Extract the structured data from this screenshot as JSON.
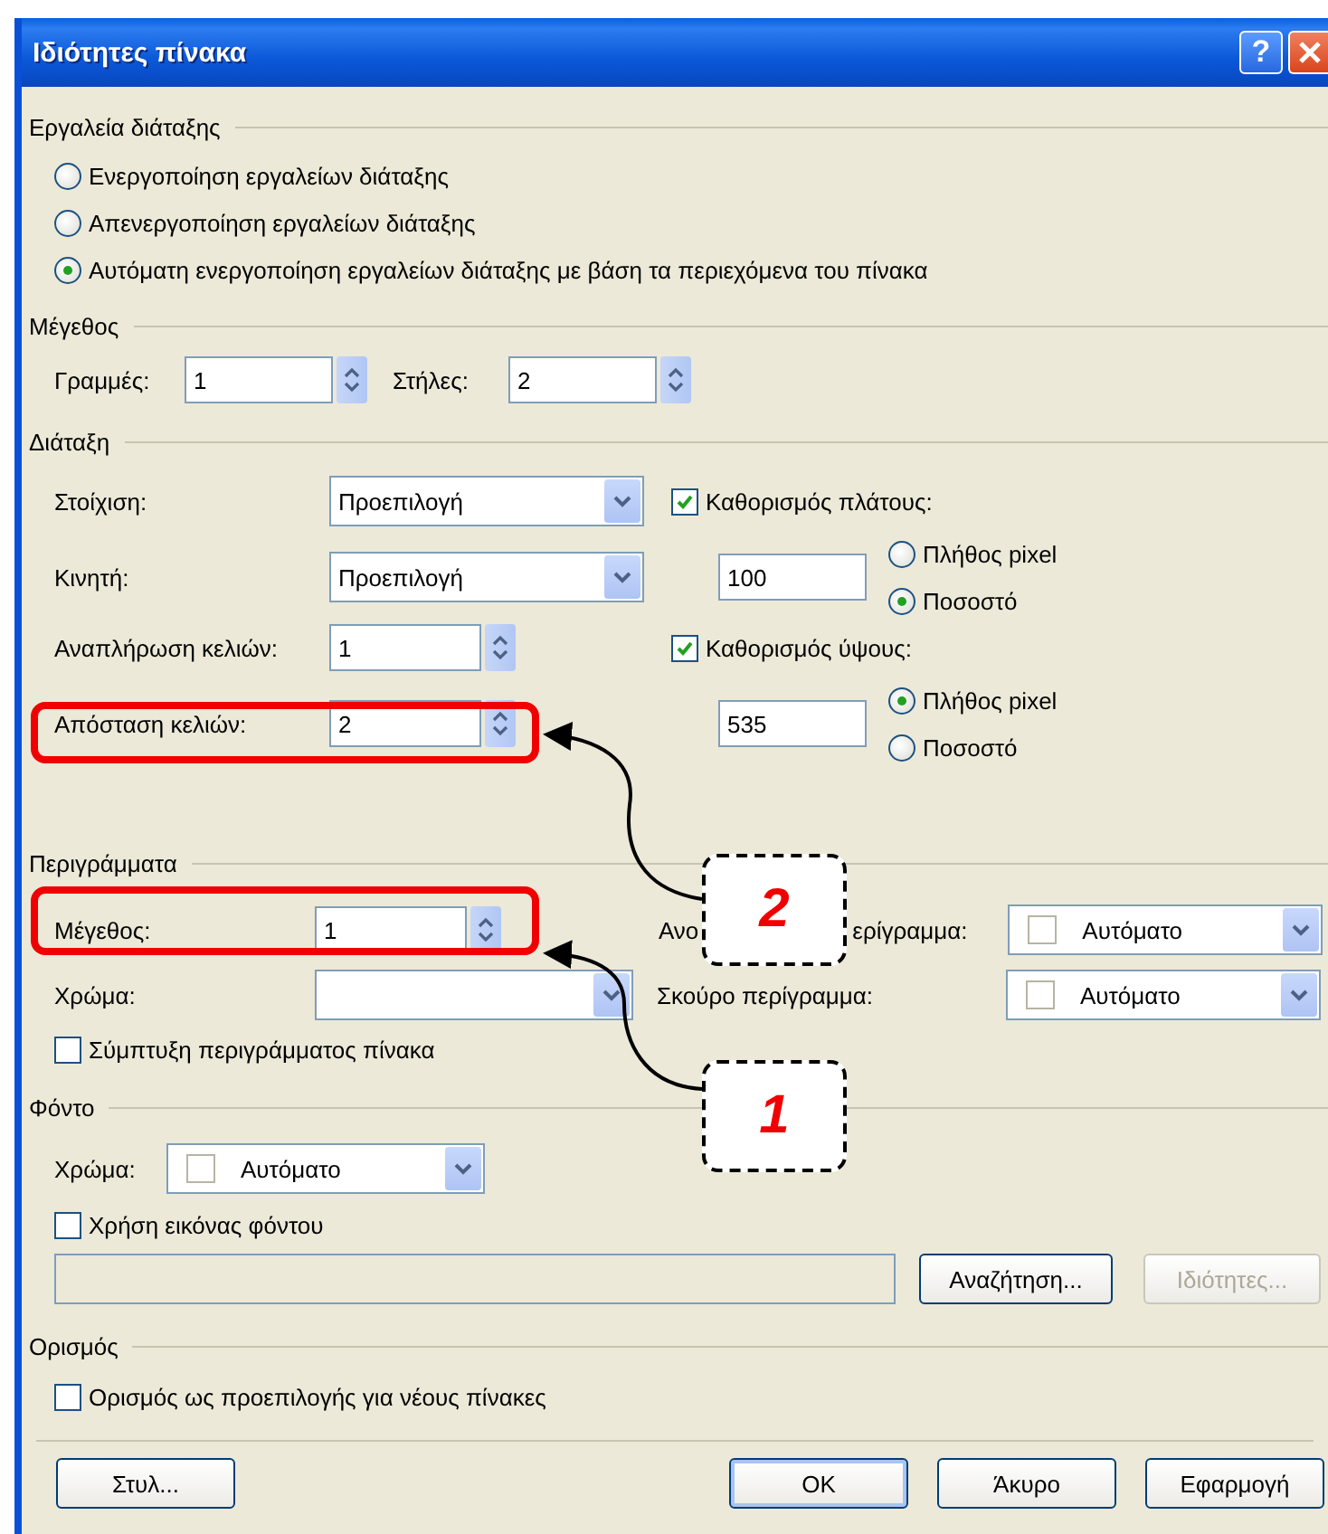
{
  "window": {
    "title": "Ιδιότητες πίνακα",
    "help_button": "?"
  },
  "layout_tools": {
    "title": "Εργαλεία διάταξης",
    "options": [
      {
        "label": "Ενεργοποίηση εργαλείων διάταξης",
        "selected": false
      },
      {
        "label": "Απενεργοποίηση εργαλείων διάταξης",
        "selected": false
      },
      {
        "label": "Αυτόματη ενεργοποίηση εργαλείων διάταξης με βάση τα περιεχόμενα του πίνακα",
        "selected": true
      }
    ]
  },
  "size": {
    "title": "Μέγεθος",
    "rows": {
      "label": "Γραμμές:",
      "value": "1"
    },
    "columns": {
      "label": "Στήλες:",
      "value": "2"
    }
  },
  "layout": {
    "title": "Διάταξη",
    "alignment": {
      "label": "Στοίχιση:",
      "value": "Προεπιλογή"
    },
    "float": {
      "label": "Κινητή:",
      "value": "Προεπιλογή"
    },
    "cell_padding": {
      "label": "Αναπλήρωση κελιών:",
      "value": "1"
    },
    "cell_spacing": {
      "label": "Απόσταση κελιών:",
      "value": "2"
    },
    "width": {
      "label": "Καθορισμός πλάτους:",
      "checked": true,
      "value": "100",
      "units": [
        {
          "label": "Πλήθος pixel",
          "selected": false
        },
        {
          "label": "Ποσοστό",
          "selected": true
        }
      ]
    },
    "height": {
      "label": "Καθορισμός ύψους:",
      "checked": true,
      "value": "535",
      "units": [
        {
          "label": "Πλήθος pixel",
          "selected": true
        },
        {
          "label": "Ποσοστό",
          "selected": false
        }
      ]
    }
  },
  "borders": {
    "title": "Περιγράμματα",
    "size": {
      "label": "Μέγεθος:",
      "value": "1"
    },
    "color": {
      "label": "Χρώμα:"
    },
    "light_border": {
      "label_start": "Ανο",
      "label_end": "ερίγραμμα:",
      "value": "Αυτόματο"
    },
    "dark_border": {
      "label": "Σκούρο περίγραμμα:",
      "value": "Αυτόματο"
    },
    "collapse": {
      "label": "Σύμπτυξη περιγράμματος πίνακα",
      "checked": false
    }
  },
  "background": {
    "title": "Φόντο",
    "color": {
      "label": "Χρώμα:",
      "value": "Αυτόματο"
    },
    "use_image": {
      "label": "Χρήση εικόνας φόντου",
      "checked": false
    },
    "buttons": [
      {
        "label": "Αναζήτηση...",
        "disabled": false
      },
      {
        "label": "Ιδιότητες...",
        "disabled": true
      }
    ]
  },
  "set": {
    "title": "Ορισμός",
    "default": {
      "label": "Ορισμός ως προεπιλογής για νέους πίνακες",
      "checked": false
    }
  },
  "footer_buttons": [
    {
      "label": "Στυλ...",
      "default": false
    },
    {
      "label": "OK",
      "default": true
    },
    {
      "label": "Άκυρο",
      "default": false
    },
    {
      "label": "Εφαρμογή",
      "default": false
    }
  ],
  "annotations": [
    {
      "label": "2"
    },
    {
      "label": "1"
    }
  ]
}
